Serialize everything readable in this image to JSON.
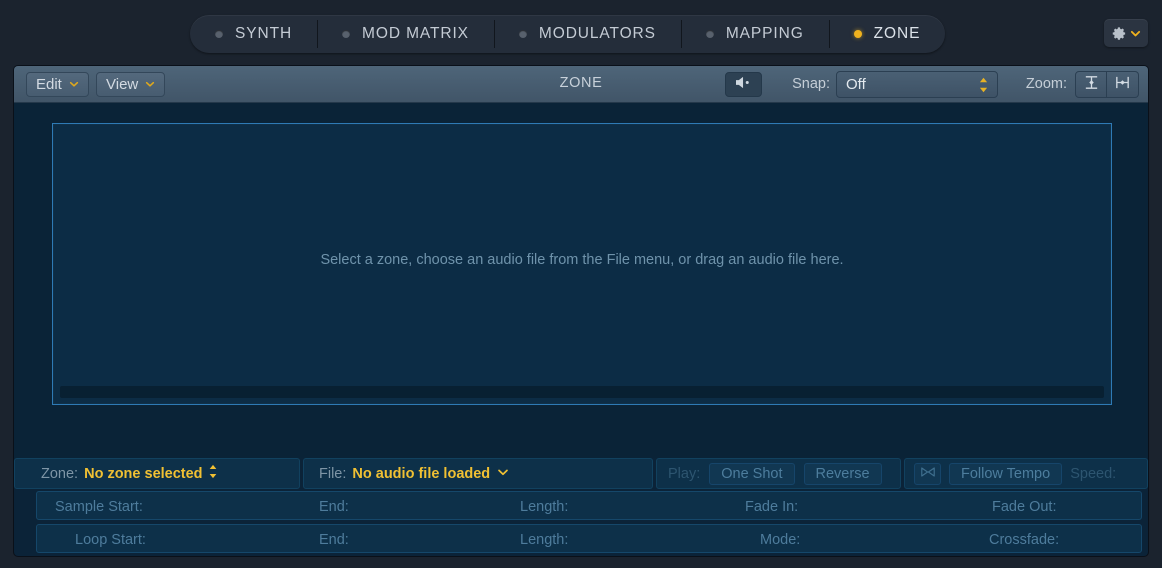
{
  "tabs": [
    {
      "label": "SYNTH",
      "active": false
    },
    {
      "label": "MOD MATRIX",
      "active": false
    },
    {
      "label": "MODULATORS",
      "active": false
    },
    {
      "label": "MAPPING",
      "active": false
    },
    {
      "label": "ZONE",
      "active": true
    }
  ],
  "gear": {
    "icon": "gear-icon",
    "chevron": "chevron-down-icon"
  },
  "toolbar": {
    "edit_label": "Edit",
    "view_label": "View",
    "title": "ZONE",
    "speaker_icon": "speaker-icon",
    "snap_label": "Snap:",
    "snap_value": "Off",
    "snap_options": [
      "Off"
    ],
    "zoom_label": "Zoom:",
    "zoom_fit_vertical_icon": "fit-vertical-icon",
    "zoom_fit_horizontal_icon": "fit-horizontal-icon"
  },
  "waveform": {
    "hint": "Select a zone, choose an audio file from the File menu, or drag an audio file here."
  },
  "info": {
    "zone_label": "Zone:",
    "zone_value": "No zone selected",
    "file_label": "File:",
    "file_value": "No audio file loaded",
    "play_label": "Play:",
    "play_one_shot": "One Shot",
    "play_reverse": "Reverse",
    "tempo_icon": "tempo-sync-icon",
    "follow_tempo": "Follow Tempo",
    "speed_label": "Speed:"
  },
  "sample_row": {
    "start": "Sample Start:",
    "end": "End:",
    "length": "Length:",
    "fade_in": "Fade In:",
    "fade_out": "Fade Out:"
  },
  "loop_row": {
    "start": "Loop Start:",
    "end": "End:",
    "length": "Length:",
    "mode": "Mode:",
    "crossfade": "Crossfade:"
  },
  "colors": {
    "accent_yellow": "#f0c033",
    "panel_blue": "#0b2338",
    "toolbar_slate": "#4a6074",
    "selection_border": "#2e7ab5"
  }
}
